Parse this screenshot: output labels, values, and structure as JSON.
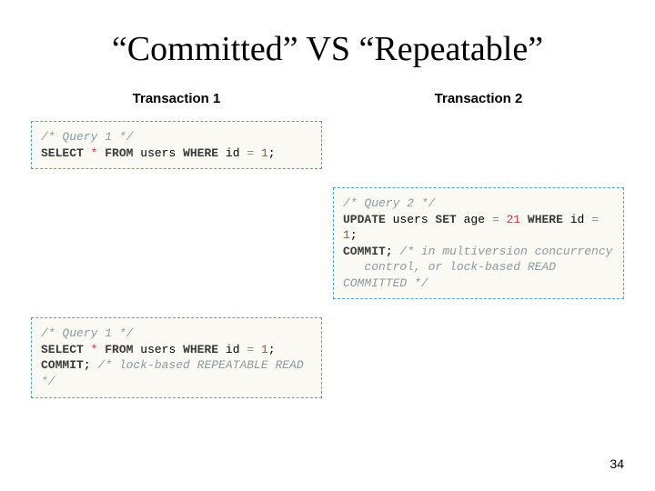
{
  "title": "“Committed” VS “Repeatable”",
  "headers": {
    "col1": "Transaction 1",
    "col2": "Transaction 2"
  },
  "cells": {
    "r1c1": {
      "tokens": [
        {
          "t": "/* Query 1 */",
          "c": "cm"
        },
        {
          "t": "\n"
        },
        {
          "t": "SELECT",
          "c": "kw"
        },
        {
          "t": " "
        },
        {
          "t": "*",
          "c": "lit"
        },
        {
          "t": " "
        },
        {
          "t": "FROM",
          "c": "kw"
        },
        {
          "t": " users "
        },
        {
          "t": "WHERE",
          "c": "kw"
        },
        {
          "t": " id "
        },
        {
          "t": "=",
          "c": "eq"
        },
        {
          "t": " "
        },
        {
          "t": "1",
          "c": "lit"
        },
        {
          "t": ";"
        }
      ]
    },
    "r2c2": {
      "tokens": [
        {
          "t": "/* Query 2 */",
          "c": "cm"
        },
        {
          "t": "\n"
        },
        {
          "t": "UPDATE",
          "c": "kw"
        },
        {
          "t": " users "
        },
        {
          "t": "SET",
          "c": "kw"
        },
        {
          "t": " age "
        },
        {
          "t": "=",
          "c": "eq"
        },
        {
          "t": " "
        },
        {
          "t": "21",
          "c": "lit"
        },
        {
          "t": " "
        },
        {
          "t": "WHERE",
          "c": "kw"
        },
        {
          "t": " id "
        },
        {
          "t": "=",
          "c": "eq"
        },
        {
          "t": " "
        },
        {
          "t": "1",
          "c": "lit"
        },
        {
          "t": ";"
        },
        {
          "t": "\n"
        },
        {
          "t": "COMMIT",
          "c": "kw"
        },
        {
          "t": "; "
        },
        {
          "t": "/* in multiversion concurrency\n   control, or lock-based READ COMMITTED */",
          "c": "cm"
        }
      ]
    },
    "r3c1": {
      "tokens": [
        {
          "t": "/* Query 1 */",
          "c": "cm"
        },
        {
          "t": "\n"
        },
        {
          "t": "SELECT",
          "c": "kw"
        },
        {
          "t": " "
        },
        {
          "t": "*",
          "c": "lit"
        },
        {
          "t": " "
        },
        {
          "t": "FROM",
          "c": "kw"
        },
        {
          "t": " users "
        },
        {
          "t": "WHERE",
          "c": "kw"
        },
        {
          "t": " id "
        },
        {
          "t": "=",
          "c": "eq"
        },
        {
          "t": " "
        },
        {
          "t": "1",
          "c": "lit"
        },
        {
          "t": ";"
        },
        {
          "t": "\n"
        },
        {
          "t": "COMMIT",
          "c": "kw"
        },
        {
          "t": "; "
        },
        {
          "t": "/* lock-based REPEATABLE READ */",
          "c": "cm"
        }
      ]
    }
  },
  "page_number": "34"
}
